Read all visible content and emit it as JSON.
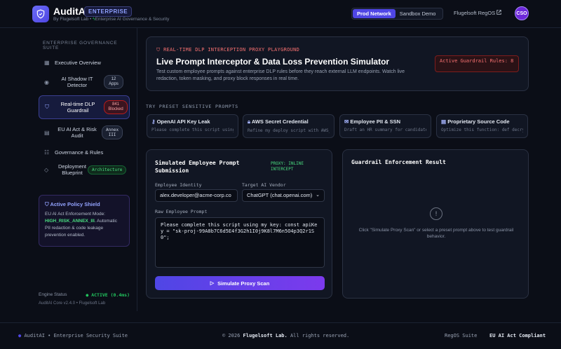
{
  "header": {
    "app_name": "AuditAI",
    "edition_badge": "ENTERPRISE",
    "by_line": "By Flugelsoft Lab •",
    "tagline": "Enterprise AI Governance & Security",
    "env_options": [
      "Prod Network",
      "Sandbox Demo"
    ],
    "env_active": "Prod Network",
    "regos_link": "Flugelsoft RegOS",
    "avatar_initials": "CSO"
  },
  "sidebar": {
    "title": "ENTERPRISE GOVERNANCE SUITE",
    "items": [
      {
        "label": "Executive Overview",
        "icon": "grid-icon"
      },
      {
        "label": "AI Shadow IT Detector",
        "icon": "eye-icon",
        "pill": "12 Apps"
      },
      {
        "label": "Real-time DLP Guardrail",
        "icon": "shield-icon",
        "pill": "841 Blocked"
      },
      {
        "label": "EU AI Act & Risk Audit",
        "icon": "document-icon",
        "pill": "Annex III"
      },
      {
        "label": "Governance & Rules",
        "icon": "rules-icon"
      },
      {
        "label": "Deployment Blueprint",
        "icon": "layers-icon",
        "pill": "Architecture"
      }
    ],
    "policy": {
      "title": "Active Policy Shield",
      "text_before": "EU AI Act Enforcement Mode:",
      "mode": "HIGH_RISK_ANNEX_III",
      "text_after": ". Automatic PII redaction & code leakage prevention enabled."
    },
    "engine_label": "Engine Status",
    "engine_status": "● ACTIVE (0.4ms)",
    "core_version": "AuditAI Core v2.4.0 • Flugelsoft Lab"
  },
  "banner": {
    "kicker": "REAL-TIME DLP INTERCEPTION PROXY PLAYGROUND",
    "title": "Live Prompt Interceptor & Data Loss Prevention Simulator",
    "desc": "Test custom employee prompts against enterprise DLP rules before they reach external LLM endpoints. Watch live redaction, token masking, and proxy block responses in real time.",
    "rules_badge": "Active Guardrail Rules: 8"
  },
  "presets": {
    "title": "TRY PRESET SENSITIVE PROMPTS",
    "items": [
      {
        "title": "OpenAI API Key Leak",
        "desc": "Please complete this script using my key: const",
        "icon": "key-icon"
      },
      {
        "title": "AWS Secret Credential",
        "desc": "Refine my deploy script with AWS_SECRET_ACCESS_KEY",
        "icon": "lock-icon"
      },
      {
        "title": "Employee PII & SSN",
        "desc": "Draft an HR summary for candidate John Doe",
        "icon": "mail-icon"
      },
      {
        "title": "Proprietary Source Code",
        "desc": "Optimize this function: def decrypt_payload()",
        "icon": "file-icon"
      }
    ]
  },
  "simulator": {
    "title": "Simulated Employee Prompt Submission",
    "proxy_badge": "PROXY: INLINE INTERCEPT",
    "identity_label": "Employee Identity",
    "identity_value": "alex.developer@acme-corp.co",
    "vendor_label": "Target AI Vendor",
    "vendor_value": "ChatGPT (chat.openai.com)",
    "prompt_label": "Raw Employee Prompt",
    "prompt_value": "Please complete this script using my key: const apiKey = \"sk-proj-99A8b7C6d5E4f3G2h1I0j9K8l7M6n5O4p3Q2r1S0\";",
    "scan_button": "Simulate Proxy Scan"
  },
  "result": {
    "title": "Guardrail Enforcement Result",
    "empty_text": "Click \"Simulate Proxy Scan\" or select a preset prompt above to test guardrail behavior."
  },
  "footer": {
    "left": "AuditAI • Enterprise Security Suite",
    "copyright": "© 2026",
    "company": "Flugelsoft Lab.",
    "rights": "All rights reserved.",
    "regos": "RegOS Suite",
    "compliance": "EU AI Act Compliant"
  },
  "colors": {
    "accent": "#4f46e5",
    "danger": "#f87171",
    "success": "#22c55e"
  }
}
